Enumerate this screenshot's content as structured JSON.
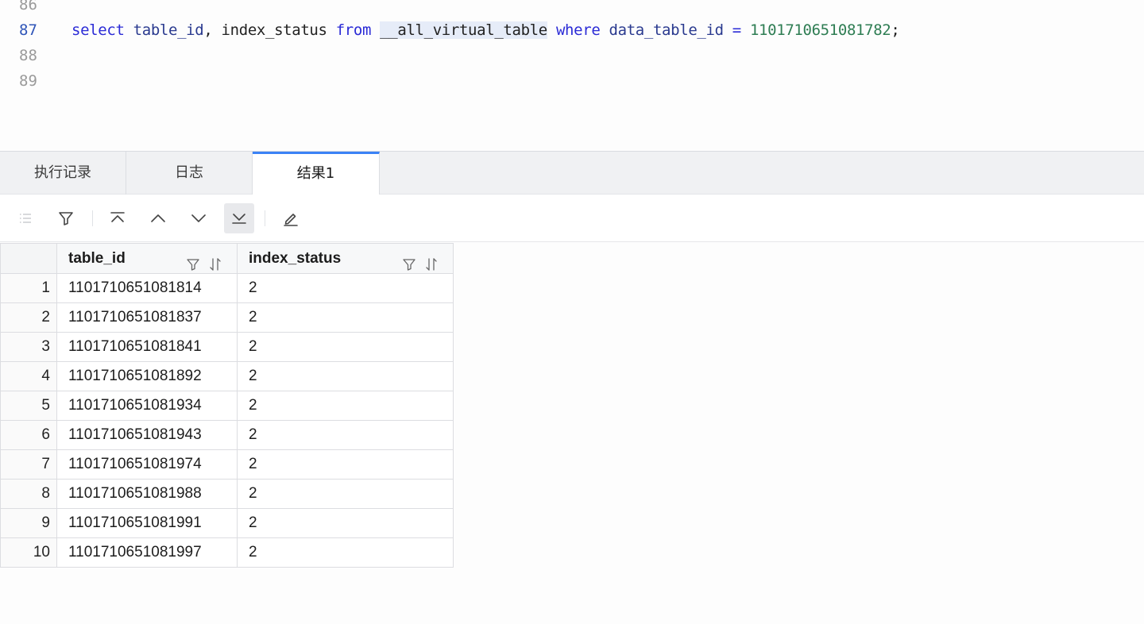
{
  "editor": {
    "lines": [
      {
        "number": "86",
        "code": ""
      },
      {
        "number": "87",
        "tokens": {
          "select": "select",
          "col1": "table_id",
          "comma": ",",
          "col2": "index_status",
          "from": "from",
          "table": "__all_virtual_table",
          "where": "where",
          "col3": "data_table_id",
          "eq": "=",
          "value": "1101710651081782",
          "semi": ";"
        }
      },
      {
        "number": "88",
        "code": ""
      },
      {
        "number": "89",
        "code": ""
      }
    ]
  },
  "tabs": [
    {
      "label": "执行记录",
      "active": false
    },
    {
      "label": "日志",
      "active": false
    },
    {
      "label": "结果1",
      "active": true
    }
  ],
  "toolbar": {
    "buttons": [
      {
        "icon": "list-icon",
        "disabled": true
      },
      {
        "icon": "filter-icon"
      },
      {
        "icon": "first-page-icon"
      },
      {
        "icon": "prev-page-icon"
      },
      {
        "icon": "next-page-icon"
      },
      {
        "icon": "last-page-icon",
        "pressed": true
      },
      {
        "icon": "edit-icon"
      }
    ]
  },
  "results": {
    "columns": [
      {
        "label": "table_id"
      },
      {
        "label": "index_status"
      }
    ],
    "rows": [
      {
        "n": "1",
        "table_id": "1101710651081814",
        "index_status": "2"
      },
      {
        "n": "2",
        "table_id": "1101710651081837",
        "index_status": "2"
      },
      {
        "n": "3",
        "table_id": "1101710651081841",
        "index_status": "2"
      },
      {
        "n": "4",
        "table_id": "1101710651081892",
        "index_status": "2"
      },
      {
        "n": "5",
        "table_id": "1101710651081934",
        "index_status": "2"
      },
      {
        "n": "6",
        "table_id": "1101710651081943",
        "index_status": "2"
      },
      {
        "n": "7",
        "table_id": "1101710651081974",
        "index_status": "2"
      },
      {
        "n": "8",
        "table_id": "1101710651081988",
        "index_status": "2"
      },
      {
        "n": "9",
        "table_id": "1101710651081991",
        "index_status": "2"
      },
      {
        "n": "10",
        "table_id": "1101710651081997",
        "index_status": "2"
      }
    ]
  },
  "colors": {
    "keyword": "#2b2bd6",
    "number": "#2e7d53",
    "active_tab_accent": "#3b82f6"
  }
}
